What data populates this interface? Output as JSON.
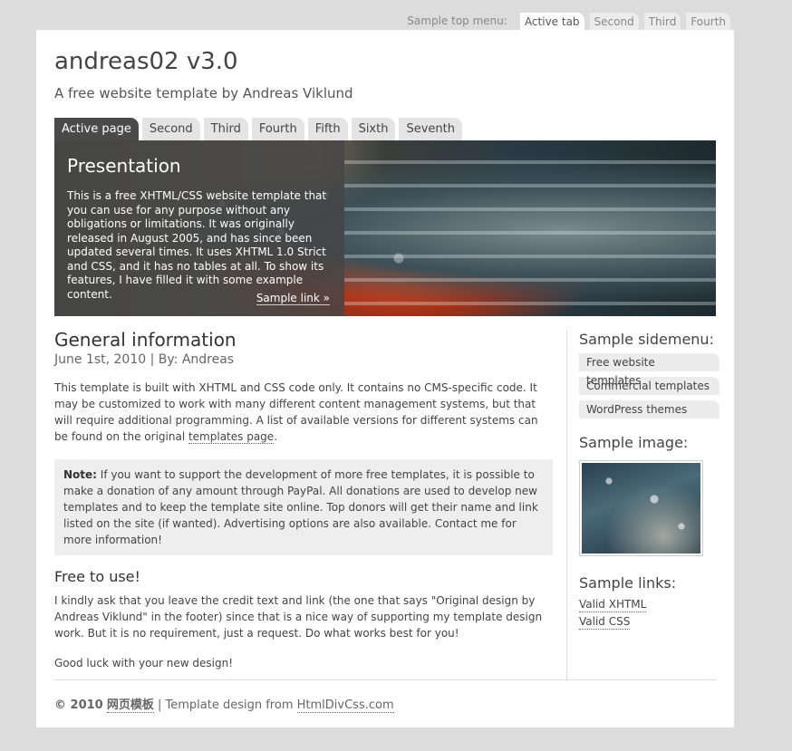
{
  "top_menu": {
    "label": "Sample top menu:",
    "tabs": [
      "Active tab",
      "Second",
      "Third",
      "Fourth"
    ]
  },
  "site": {
    "title": "andreas02 v3.0",
    "subtitle": "A free website template by Andreas Viklund"
  },
  "main_menu": {
    "tabs": [
      "Active page",
      "Second",
      "Third",
      "Fourth",
      "Fifth",
      "Sixth",
      "Seventh"
    ]
  },
  "presentation": {
    "title": "Presentation",
    "text": "This is a free XHTML/CSS website template that you can use for any purpose without any obligations or limitations. It was originally released in August 2005, and has since been updated several times. It uses XHTML 1.0 Strict and CSS, and it has no tables at all. To show its features, I have filled it with some example content.",
    "link": "Sample link »"
  },
  "article": {
    "title": "General information",
    "meta": "June 1st, 2010 | By: Andreas",
    "para1_a": "This template is built with XHTML and CSS code only. It contains no CMS-specific code. It may be customized to work with many different content management systems, but that will require additional programming. A list of available versions for different systems can be found on the original ",
    "para1_link": "templates page",
    "para1_b": ".",
    "note_label": "Note:",
    "note_text": " If you want to support the development of more free templates, it is possible to make a donation of any amount through PayPal. All donations are used to develop new templates and to keep the template site online. Top donors will get their name and link listed on the site (if wanted). Advertising options are also available. Contact me for more information!",
    "subtitle": "Free to use!",
    "para2": "I kindly ask that you leave the credit text and link (the one that says \"Original design by Andreas Viklund\" in the footer) since that is a nice way of supporting my template design work. But it is no requirement, just a request. Do what works best for you!",
    "para3": "Good luck with your new design!"
  },
  "sidebar": {
    "menu_title": "Sample sidemenu:",
    "menu_items": [
      "Free website templates",
      "Commercial templates",
      "WordPress themes"
    ],
    "image_title": "Sample image:",
    "links_title": "Sample links:",
    "links": [
      "Valid XHTML",
      "Valid CSS"
    ]
  },
  "footer": {
    "copyright": "© 2010",
    "site_link": "网页模板",
    "separator": " | Template design from ",
    "design_link": "HtmlDivCss.com"
  }
}
